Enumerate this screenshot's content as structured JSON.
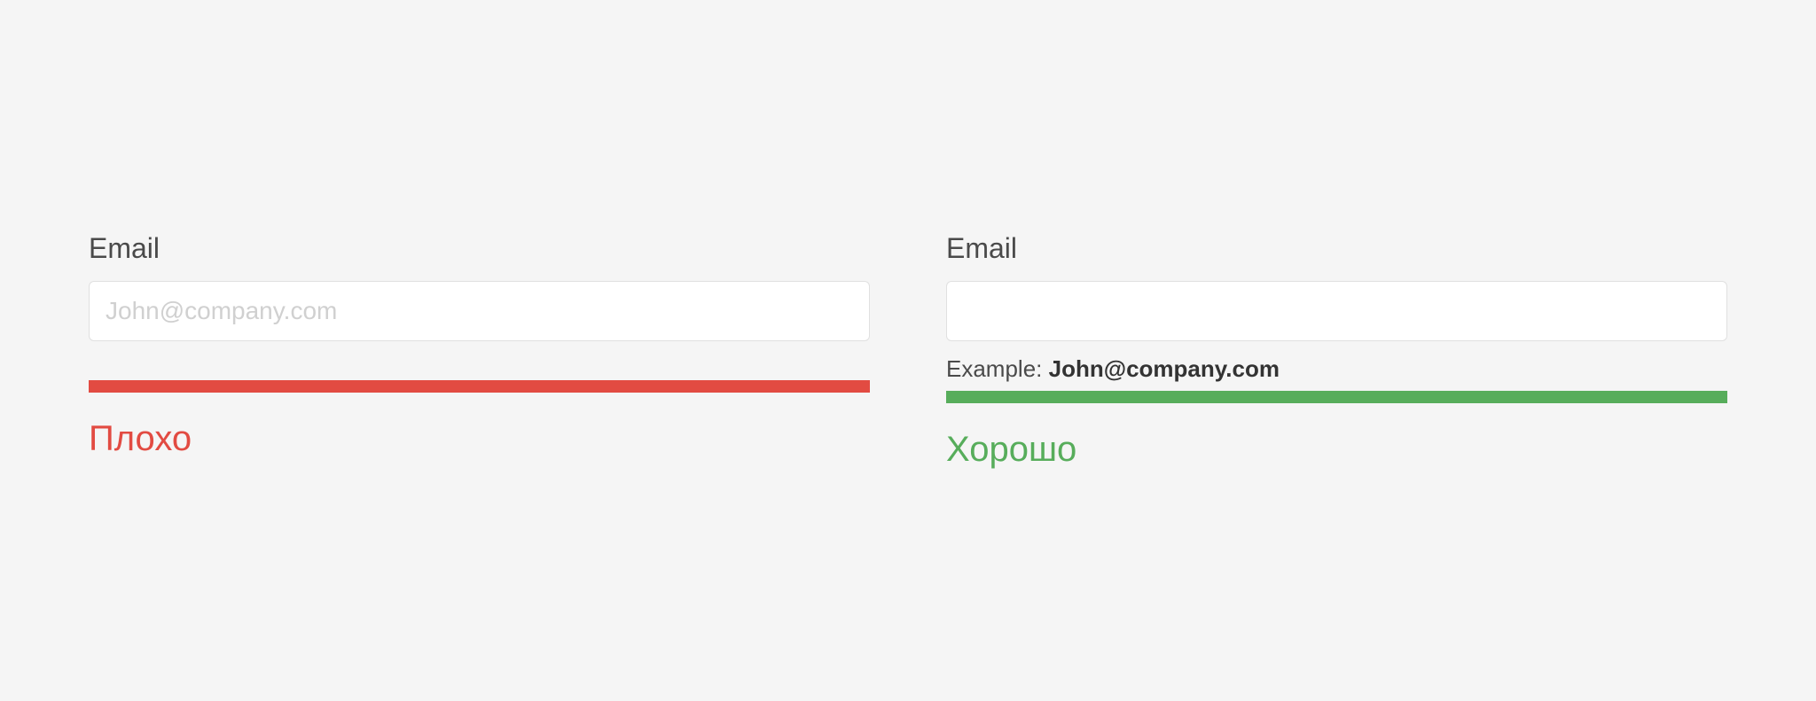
{
  "bad": {
    "label": "Email",
    "placeholder": "John@company.com",
    "verdict": "Плохо"
  },
  "good": {
    "label": "Email",
    "hint_prefix": "Example: ",
    "hint_value": "John@company.com",
    "verdict": "Хорошо"
  },
  "colors": {
    "bad": "#e24b42",
    "good": "#57ad5b"
  }
}
